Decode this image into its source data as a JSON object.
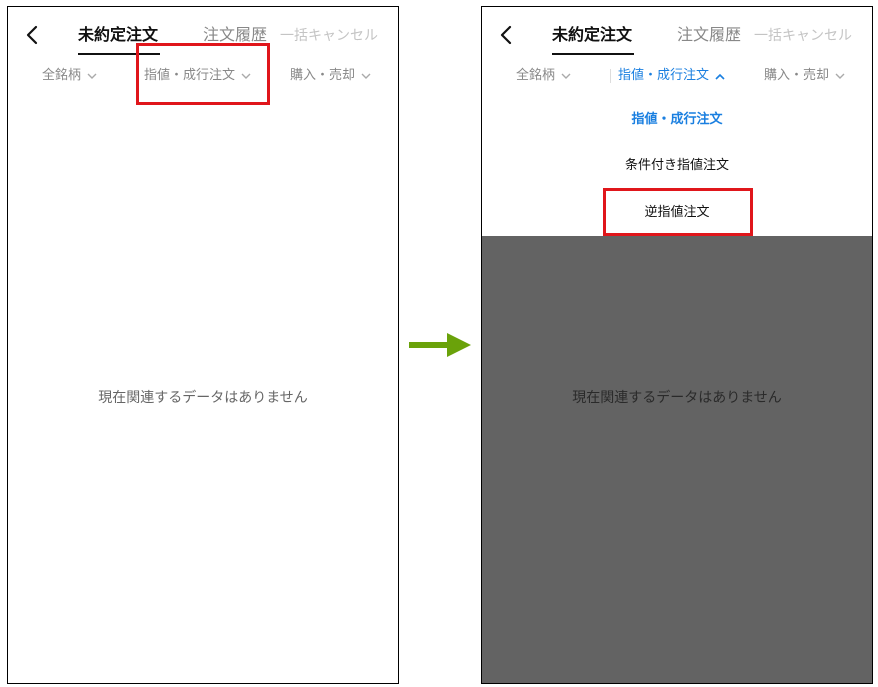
{
  "left_screen": {
    "tabs": {
      "active": "未約定注文",
      "history": "注文履歴",
      "cancel_all": "一括キャンセル"
    },
    "filters": {
      "symbol": "全銘柄",
      "order_type": "指値・成行注文",
      "side": "購入・売却"
    },
    "empty_message": "現在関連するデータはありません"
  },
  "right_screen": {
    "tabs": {
      "active": "未約定注文",
      "history": "注文履歴",
      "cancel_all": "一括キャンセル"
    },
    "filters": {
      "symbol": "全銘柄",
      "order_type": "指値・成行注文",
      "side": "購入・売却"
    },
    "dropdown_options": [
      "指値・成行注文",
      "条件付き指値注文",
      "逆指値注文"
    ],
    "selected_option": "指値・成行注文",
    "empty_message": "現在関連するデータはありません"
  },
  "colors": {
    "accent": "#1a7fe0",
    "highlight": "#e0161b",
    "arrow": "#6aa20a",
    "overlay": "#636363"
  },
  "icons": {
    "back": "chevron-left-icon",
    "dropdown": "chevron-down-icon",
    "dropdown_open": "chevron-up-icon",
    "transition": "arrow-right-icon"
  }
}
